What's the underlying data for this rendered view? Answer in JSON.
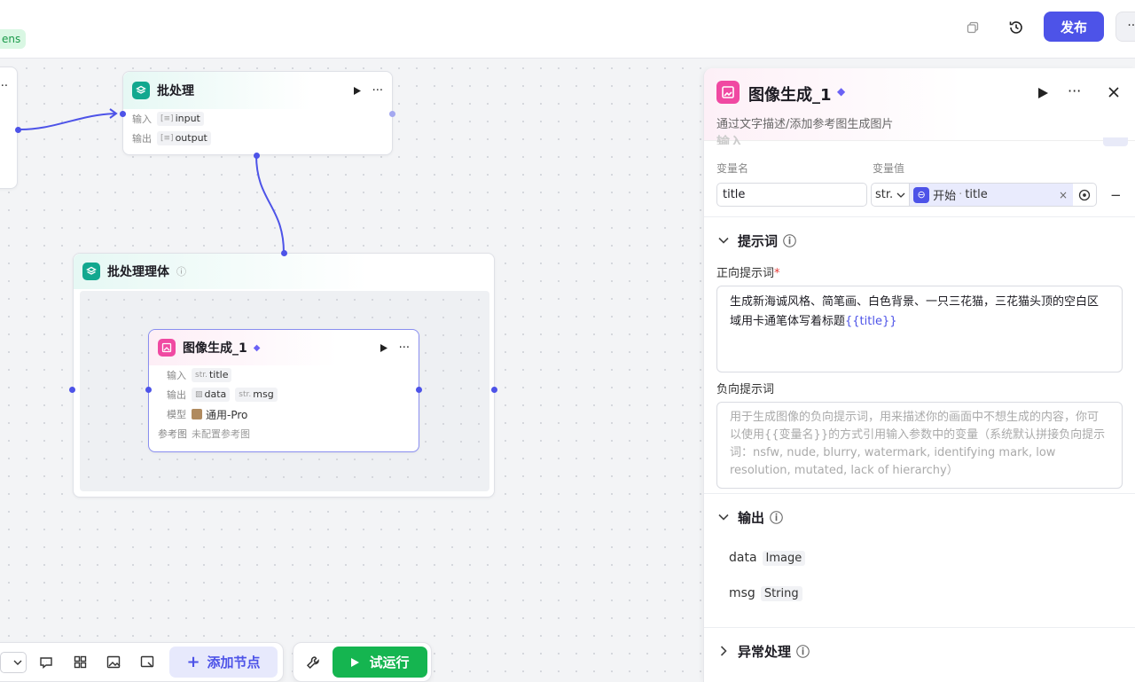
{
  "topbar": {
    "badge": "ens",
    "publish_label": "发布",
    "more_label": "···"
  },
  "canvas": {
    "batch_node": {
      "title": "批处理",
      "input_label": "输入",
      "input_value": "input",
      "output_label": "输出",
      "output_value": "output"
    },
    "batch_body": {
      "title": "批处理理体"
    },
    "image_node": {
      "title": "图像生成_1",
      "input_label": "输入",
      "input_type": "str.",
      "input_value": "title",
      "output_label": "输出",
      "output_value1": "data",
      "output_type2": "str.",
      "output_value2": "msg",
      "model_label": "模型",
      "model_value": "通用-Pro",
      "ref_label": "参考图",
      "ref_value": "未配置参考图"
    }
  },
  "bottom_toolbar": {
    "add_node_label": "添加节点",
    "test_run_label": "试运行"
  },
  "panel": {
    "title": "图像生成_1",
    "description": "通过文字描述/添加参考图生成图片",
    "input_section": {
      "partial_header": "输入",
      "var_name_header": "变量名",
      "var_value_header": "变量值",
      "var_name": "title",
      "var_type": "str.",
      "ref_source": "开始",
      "ref_sep": "·",
      "ref_var": "title"
    },
    "prompt_section": {
      "title": "提示词",
      "positive_label": "正向提示词",
      "required_mark": "*",
      "positive_text": "生成新海诚风格、简笔画、白色背景、一只三花猫，三花猫头顶的空白区域用卡通笔体写着标题",
      "positive_var": "{{title}}",
      "negative_label": "负向提示词",
      "negative_placeholder": "用于生成图像的负向提示词，用来描述你的画面中不想生成的内容，你可以使用{{变量名}}的方式引用输入参数中的变量（系统默认拼接负向提示词：nsfw, nude, blurry, watermark, identifying mark, low resolution, mutated, lack of hierarchy）"
    },
    "output_section": {
      "title": "输出",
      "outputs": [
        {
          "name": "data",
          "type": "Image"
        },
        {
          "name": "msg",
          "type": "String"
        }
      ]
    },
    "error_section": {
      "title": "异常处理"
    }
  },
  "colors": {
    "accent": "#4d53e8",
    "run_green": "#15b550",
    "image_pink": "#f049a2",
    "batch_teal": "#12a88f"
  }
}
